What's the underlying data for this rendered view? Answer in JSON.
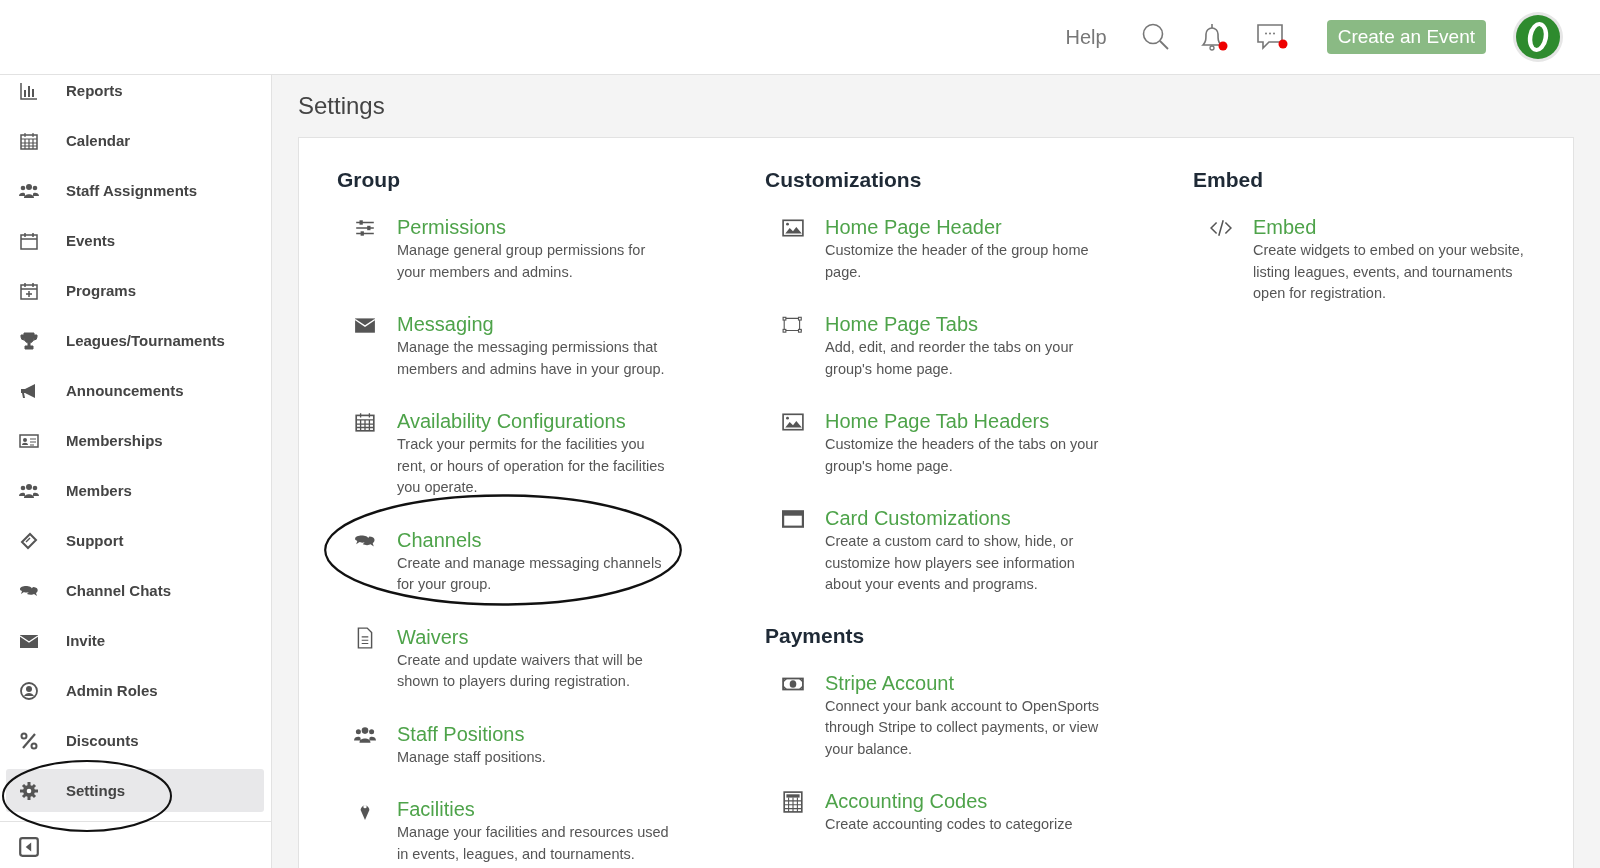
{
  "header": {
    "help": "Help",
    "notifications": {
      "unread": true
    },
    "messages": {
      "unread": true
    },
    "create_button": "Create an Event"
  },
  "sidebar": {
    "items": [
      {
        "label": "Reports",
        "selected": false,
        "circled": false
      },
      {
        "label": "Calendar",
        "selected": false,
        "circled": false
      },
      {
        "label": "Staff Assignments",
        "selected": false,
        "circled": false
      },
      {
        "label": "Events",
        "selected": false,
        "circled": false
      },
      {
        "label": "Programs",
        "selected": false,
        "circled": false
      },
      {
        "label": "Leagues/Tournaments",
        "selected": false,
        "circled": false
      },
      {
        "label": "Announcements",
        "selected": false,
        "circled": false
      },
      {
        "label": "Memberships",
        "selected": false,
        "circled": false
      },
      {
        "label": "Members",
        "selected": false,
        "circled": false
      },
      {
        "label": "Support",
        "selected": false,
        "circled": false
      },
      {
        "label": "Channel Chats",
        "selected": false,
        "circled": false
      },
      {
        "label": "Invite",
        "selected": false,
        "circled": false
      },
      {
        "label": "Admin Roles",
        "selected": false,
        "circled": false
      },
      {
        "label": "Discounts",
        "selected": false,
        "circled": false
      },
      {
        "label": "Settings",
        "selected": true,
        "circled": true
      }
    ]
  },
  "page": {
    "title": "Settings",
    "columns": [
      {
        "sections": [
          {
            "title": "Group",
            "items": [
              {
                "title": "Permissions",
                "description": "Manage general group permissions for your members and admins.",
                "circled": false
              },
              {
                "title": "Messaging",
                "description": "Manage the messaging permissions that members and admins have in your group.",
                "circled": false
              },
              {
                "title": "Availability Configurations",
                "description": "Track your permits for the facilities you rent, or hours of operation for the facilities you operate.",
                "circled": false
              },
              {
                "title": "Channels",
                "description": "Create and manage messaging channels for your group.",
                "circled": true
              },
              {
                "title": "Waivers",
                "description": "Create and update waivers that will be shown to players during registration.",
                "circled": false
              },
              {
                "title": "Staff Positions",
                "description": "Manage staff positions.",
                "circled": false
              },
              {
                "title": "Facilities",
                "description": "Manage your facilities and resources used in events, leagues, and tournaments.",
                "circled": false
              }
            ]
          }
        ]
      },
      {
        "sections": [
          {
            "title": "Customizations",
            "items": [
              {
                "title": "Home Page Header",
                "description": "Customize the header of the group home page.",
                "circled": false
              },
              {
                "title": "Home Page Tabs",
                "description": "Add, edit, and reorder the tabs on your group's home page.",
                "circled": false
              },
              {
                "title": "Home Page Tab Headers",
                "description": "Customize the headers of the tabs on your group's home page.",
                "circled": false
              },
              {
                "title": "Card Customizations",
                "description": "Create a custom card to show, hide, or customize how players see information about your events and programs.",
                "circled": false
              }
            ]
          },
          {
            "title": "Payments",
            "items": [
              {
                "title": "Stripe Account",
                "description": "Connect your bank account to OpenSports through Stripe to collect payments, or view your balance.",
                "circled": false
              },
              {
                "title": "Accounting Codes",
                "description": "Create accounting codes to categorize",
                "circled": false
              }
            ]
          }
        ]
      },
      {
        "sections": [
          {
            "title": "Embed",
            "items": [
              {
                "title": "Embed",
                "description": "Create widgets to embed on your website, listing leagues, events, and tournaments open for registration.",
                "circled": false
              }
            ]
          }
        ]
      }
    ]
  }
}
